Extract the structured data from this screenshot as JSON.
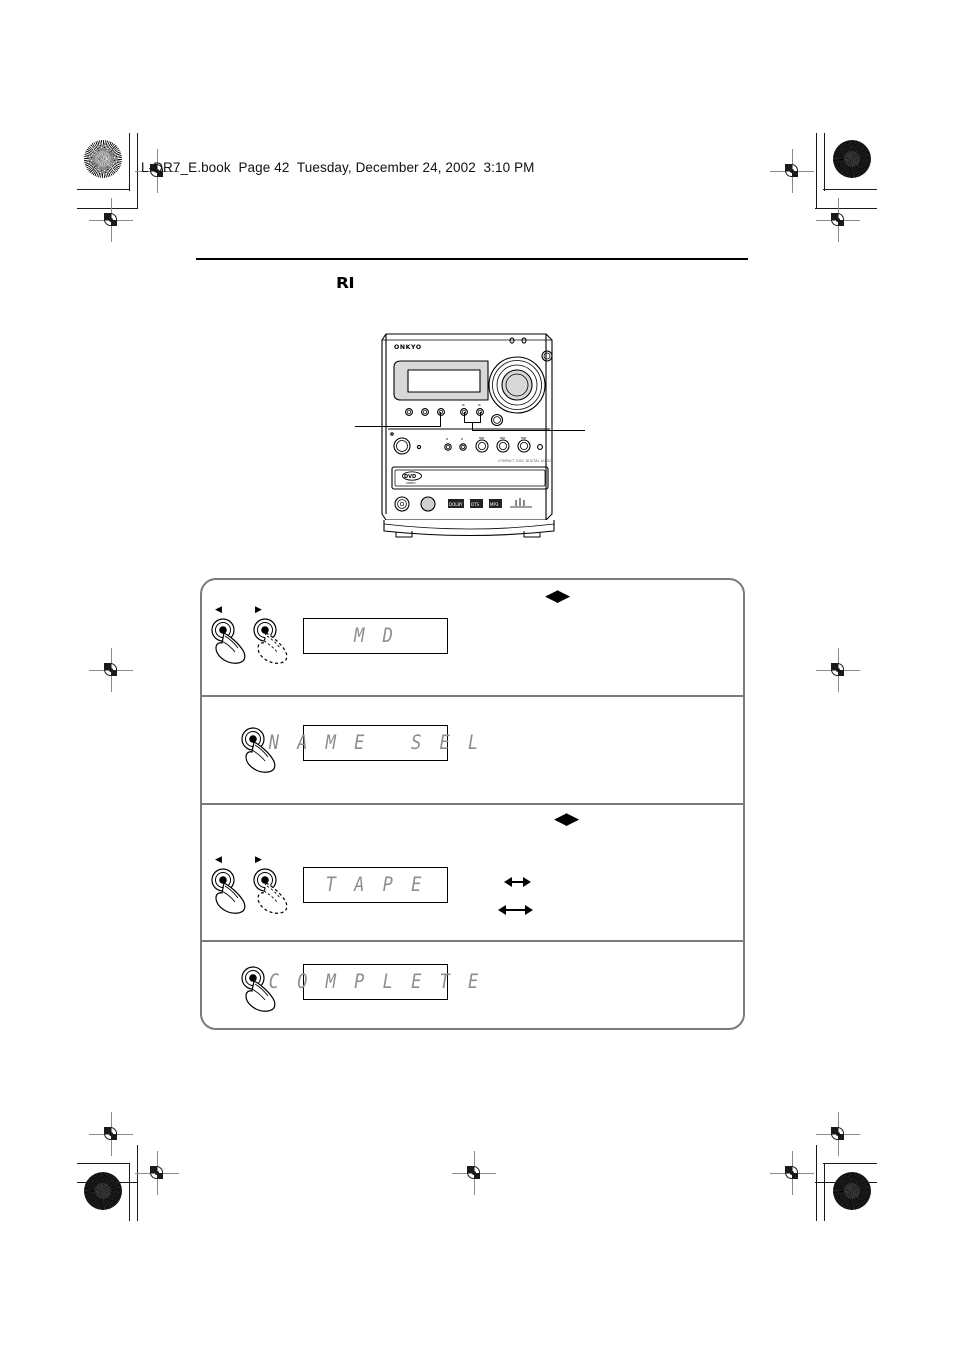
{
  "page": {
    "file_header": "L-DR7_E.book  Page 42  Tuesday, December 24, 2002  3:10 PM",
    "section_logo": "RI"
  },
  "device": {
    "brand": "ONKYO",
    "disc_label": "DVD",
    "disc_sublabel": "VIDEO",
    "format_badges": [
      "DOLBY DIGITAL",
      "DTS",
      "MP3",
      "DIGITAL"
    ],
    "panel_text": "COMPACT DISC DIGITAL AUDIO"
  },
  "callouts": {
    "left_label": "",
    "right_label": ""
  },
  "steps": [
    {
      "id": "step-1",
      "display": "M D",
      "lr_marks": "◀▶",
      "hands": [
        "solid",
        "dashed"
      ],
      "hand_arrows": [
        "◀",
        "▶"
      ],
      "arrows": []
    },
    {
      "id": "step-2",
      "display": "N A M E   S E L",
      "lr_marks": "",
      "hands": [
        "solid"
      ],
      "hand_arrows": [],
      "arrows": []
    },
    {
      "id": "step-3",
      "display": "T A P E",
      "lr_marks": "◀▶",
      "hands": [
        "solid",
        "dashed"
      ],
      "hand_arrows": [
        "◀",
        "▶"
      ],
      "arrows": [
        "short",
        "long"
      ]
    },
    {
      "id": "step-4",
      "display": "C O M P L E T E",
      "lr_marks": "",
      "hands": [
        "solid"
      ],
      "hand_arrows": [],
      "arrows": []
    }
  ],
  "colors": {
    "ink": "#000000",
    "frame": "#7b7b7b",
    "lcd_text": "#8d8d8d",
    "device_gray": "#d8d8d8"
  }
}
